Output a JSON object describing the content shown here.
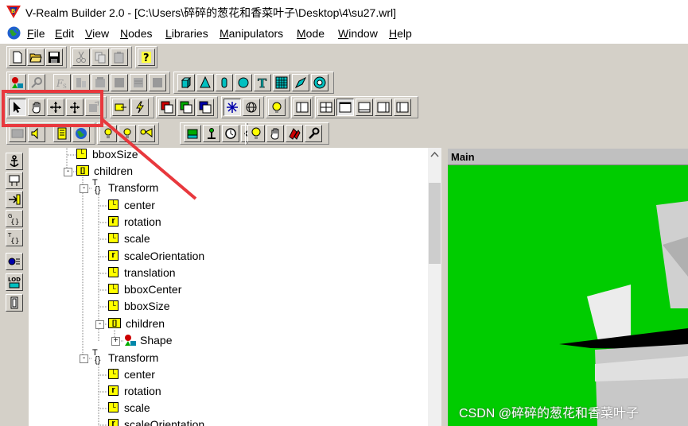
{
  "window": {
    "title": "V-Realm Builder 2.0 - [C:\\Users\\碎碎的葱花和香菜叶子\\Desktop\\4\\su27.wrl]"
  },
  "menu": [
    "File",
    "Edit",
    "View",
    "Nodes",
    "Libraries",
    "Manipulators",
    "Mode",
    "Window",
    "Help"
  ],
  "tree": [
    {
      "label": "bboxSize",
      "icon": "field-icon",
      "expander": ""
    },
    {
      "label": "children",
      "icon": "children-icon",
      "expander": "-"
    },
    {
      "label": "Transform",
      "icon": "transform-icon",
      "expander": "-"
    },
    {
      "label": "center",
      "icon": "field-icon",
      "expander": ""
    },
    {
      "label": "rotation",
      "icon": "rotation-field-icon",
      "expander": ""
    },
    {
      "label": "scale",
      "icon": "field-icon",
      "expander": ""
    },
    {
      "label": "scaleOrientation",
      "icon": "rotation-field-icon",
      "expander": ""
    },
    {
      "label": "translation",
      "icon": "field-icon",
      "expander": ""
    },
    {
      "label": "bboxCenter",
      "icon": "field-icon",
      "expander": ""
    },
    {
      "label": "bboxSize",
      "icon": "field-icon",
      "expander": ""
    },
    {
      "label": "children",
      "icon": "children-icon",
      "expander": "-"
    },
    {
      "label": "Shape",
      "icon": "shape-icon",
      "expander": "+"
    },
    {
      "label": "Transform",
      "icon": "transform-icon",
      "expander": "-"
    },
    {
      "label": "center",
      "icon": "field-icon",
      "expander": ""
    },
    {
      "label": "rotation",
      "icon": "rotation-field-icon",
      "expander": ""
    },
    {
      "label": "scale",
      "icon": "field-icon",
      "expander": ""
    },
    {
      "label": "scaleOrientation",
      "icon": "rotation-field-icon",
      "expander": ""
    }
  ],
  "main_window": {
    "title": "Main"
  },
  "watermark": "CSDN @碎碎的葱花和香菜叶子",
  "colors": {
    "viewport_bg": "#00cc00",
    "annotation": "#e8383d",
    "field_icon": "#ffff00"
  },
  "highlight": {
    "note": ""
  }
}
